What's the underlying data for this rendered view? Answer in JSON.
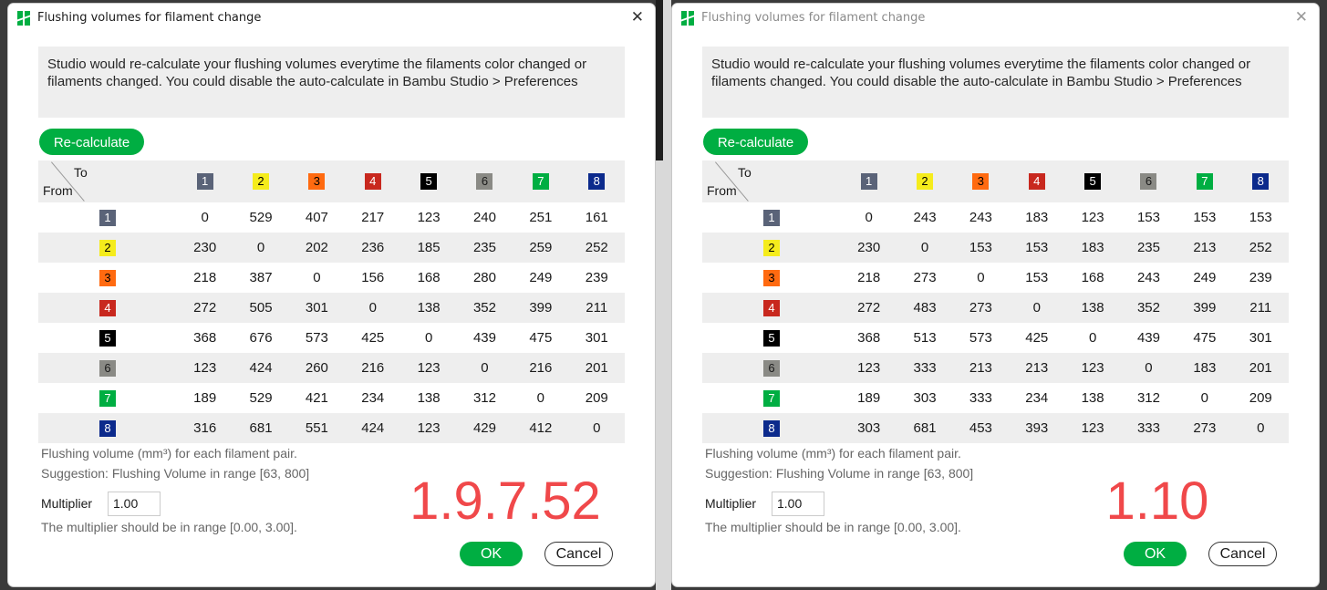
{
  "filaments": [
    {
      "label": "1",
      "color": "#5a6378",
      "text": "#ffffff"
    },
    {
      "label": "2",
      "color": "#f5ec1c",
      "text": "#000000"
    },
    {
      "label": "3",
      "color": "#ff6a10",
      "text": "#000000"
    },
    {
      "label": "4",
      "color": "#c8281e",
      "text": "#ffffff"
    },
    {
      "label": "5",
      "color": "#000000",
      "text": "#ffffff"
    },
    {
      "label": "6",
      "color": "#8a8a85",
      "text": "#1a1a1a"
    },
    {
      "label": "7",
      "color": "#00ae42",
      "text": "#ffffff"
    },
    {
      "label": "8",
      "color": "#0c2a8c",
      "text": "#ffffff"
    }
  ],
  "dialogs": [
    {
      "title": "Flushing volumes for filament change",
      "active": true,
      "info": "Studio would re-calculate your flushing volumes everytime the filaments color changed or filaments changed. You could disable the auto-calculate in Bambu Studio > Preferences",
      "recalculate_label": "Re-calculate",
      "header_to": "To",
      "header_from": "From",
      "matrix": [
        [
          0,
          529,
          407,
          217,
          123,
          240,
          251,
          161
        ],
        [
          230,
          0,
          202,
          236,
          185,
          235,
          259,
          252
        ],
        [
          218,
          387,
          0,
          156,
          168,
          280,
          249,
          239
        ],
        [
          272,
          505,
          301,
          0,
          138,
          352,
          399,
          211
        ],
        [
          368,
          676,
          573,
          425,
          0,
          439,
          475,
          301
        ],
        [
          123,
          424,
          260,
          216,
          123,
          0,
          216,
          201
        ],
        [
          189,
          529,
          421,
          234,
          138,
          312,
          0,
          209
        ],
        [
          316,
          681,
          551,
          424,
          123,
          429,
          412,
          0
        ]
      ],
      "note1": "Flushing volume (mm³) for each filament pair.",
      "note2": "Suggestion: Flushing Volume in range [63, 800]",
      "multiplier_label": "Multiplier",
      "multiplier_value": "1.00",
      "multiplier_note": "The multiplier should be in range [0.00, 3.00].",
      "version_annotation": "1.9.7.52",
      "ok_label": "OK",
      "cancel_label": "Cancel"
    },
    {
      "title": "Flushing volumes for filament change",
      "active": false,
      "info": "Studio would re-calculate your flushing volumes everytime the filaments color changed or filaments changed. You could disable the auto-calculate in Bambu Studio > Preferences",
      "recalculate_label": "Re-calculate",
      "header_to": "To",
      "header_from": "From",
      "matrix": [
        [
          0,
          243,
          243,
          183,
          123,
          153,
          153,
          153
        ],
        [
          230,
          0,
          153,
          153,
          183,
          235,
          213,
          252
        ],
        [
          218,
          273,
          0,
          153,
          168,
          243,
          249,
          239
        ],
        [
          272,
          483,
          273,
          0,
          138,
          352,
          399,
          211
        ],
        [
          368,
          513,
          573,
          425,
          0,
          439,
          475,
          301
        ],
        [
          123,
          333,
          213,
          213,
          123,
          0,
          183,
          201
        ],
        [
          189,
          303,
          333,
          234,
          138,
          312,
          0,
          209
        ],
        [
          303,
          681,
          453,
          393,
          123,
          333,
          273,
          0
        ]
      ],
      "note1": "Flushing volume (mm³) for each filament pair.",
      "note2": "Suggestion: Flushing Volume in range [63, 800]",
      "multiplier_label": "Multiplier",
      "multiplier_value": "1.00",
      "multiplier_note": "The multiplier should be in range [0.00, 3.00].",
      "version_annotation": "1.10",
      "ok_label": "OK",
      "cancel_label": "Cancel"
    }
  ]
}
